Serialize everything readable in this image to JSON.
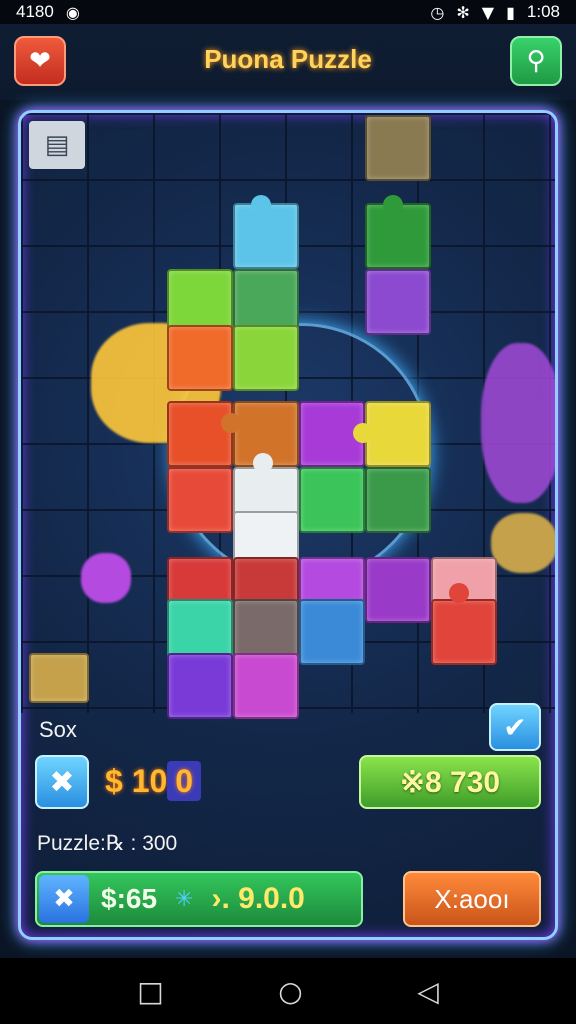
{
  "status_bar": {
    "left_text": "4180",
    "time": "1:08",
    "icons": [
      "app-badge-icon",
      "alarm-icon",
      "vibrate-icon",
      "wifi-icon",
      "battery-icon"
    ]
  },
  "header": {
    "title": "Puona Puzzle",
    "left_icon": "heart-icon",
    "right_icon": "search-icon"
  },
  "board": {
    "corner_icon": "window-icon"
  },
  "panel": {
    "label": "Sox",
    "check_icon": "checkmark-icon",
    "x_icon": "x-icon",
    "coin_prefix": "$",
    "coin_value": "10",
    "coin_highlight": "0",
    "green_stat": "※8  730",
    "puzzle_info": "Puzzle:℞ : 300",
    "bottom_bar_text": "$:65",
    "bottom_bar_spark": "✳",
    "bottom_bar_value": "›. 9.0.0",
    "orange_button": "X:aooı"
  },
  "nav": {
    "recent": "□",
    "home": "○",
    "back": "◁"
  },
  "colors": {
    "accent_gold": "#ffd35c",
    "neon_blue": "#3fb0ff",
    "neon_purple": "#b34dff",
    "green": "#33c65c",
    "orange": "#ff8a3a"
  }
}
